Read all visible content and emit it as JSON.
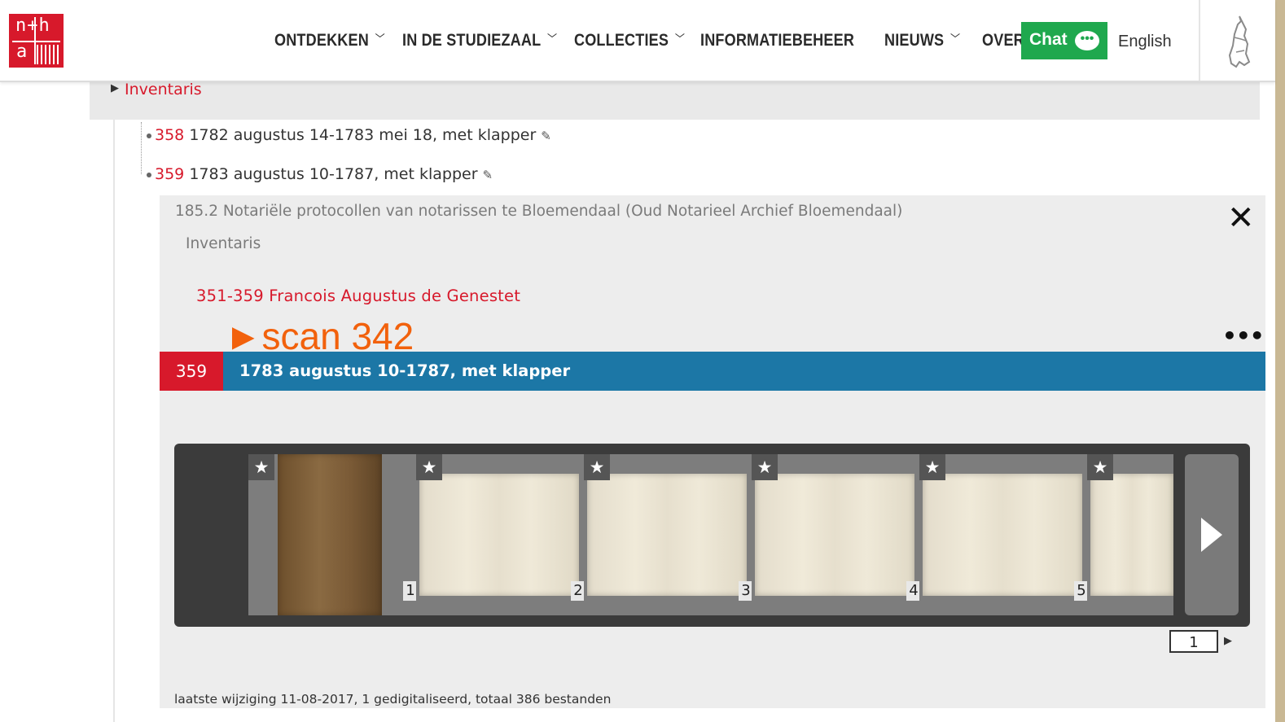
{
  "logo": {
    "top": "n+h",
    "bottom": "a"
  },
  "nav": {
    "items": [
      {
        "label": "ONTDEKKEN",
        "chevron": true
      },
      {
        "label": "IN DE STUDIEZAAL",
        "chevron": true
      },
      {
        "label": "COLLECTIES",
        "chevron": true
      },
      {
        "label": "INFORMATIEBEHEER",
        "chevron": false
      },
      {
        "label": "NIEUWS",
        "chevron": true
      },
      {
        "label": "OVER",
        "chevron": false
      }
    ],
    "chat_label": "Chat",
    "chat_icon": "•••",
    "language": "English"
  },
  "tree": {
    "root_label": "Inventaris",
    "rows": [
      {
        "num": "358",
        "text": "1782 augustus 14-1783 mei 18, met klapper"
      },
      {
        "num": "359",
        "text": "1783 augustus 10-1787, met klapper"
      }
    ]
  },
  "panel": {
    "breadcrumb": "185.2 Notariële protocollen van notarissen te Bloemendaal (Oud Notarieel Archief Bloemendaal)",
    "breadcrumb_sub": "Inventaris",
    "series_link": "351-359 Francois Augustus de Genestet",
    "annotation": "►scan 342",
    "more": "•••",
    "record_num": "359",
    "record_title": "1783 augustus 10-1787, met klapper",
    "close": "✕"
  },
  "viewer": {
    "thumbnails": [
      {
        "label": "1"
      },
      {
        "label": "2"
      },
      {
        "label": "3"
      },
      {
        "label": "4"
      },
      {
        "label": "5"
      },
      {
        "label": ""
      }
    ],
    "page_input": "1"
  },
  "footer": {
    "text": "laatste wijziging 11-08-2017, 1 gedigitaliseerd, totaal 386 bestanden"
  }
}
